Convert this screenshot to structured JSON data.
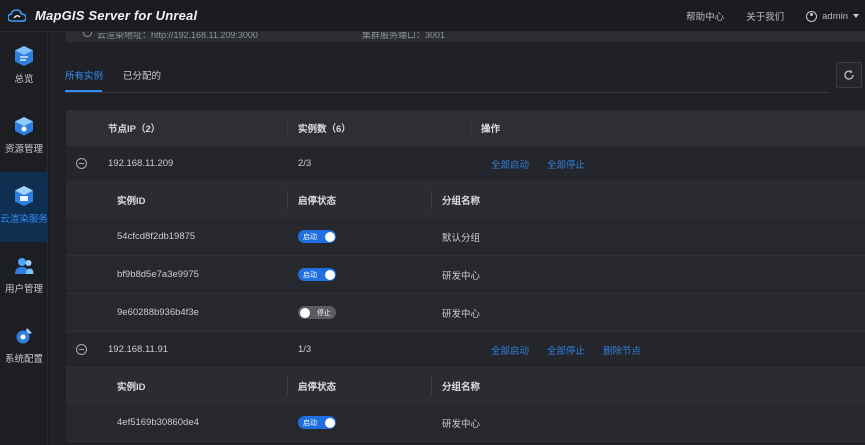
{
  "app": {
    "title": "MapGIS Server for Unreal"
  },
  "header": {
    "help": "帮助中心",
    "about": "关于我们",
    "user": "admin"
  },
  "sidebar": {
    "items": [
      {
        "label": "总览",
        "icon": "overview-icon",
        "active": false
      },
      {
        "label": "资源管理",
        "icon": "resource-icon",
        "active": false
      },
      {
        "label": "云渲染服务",
        "icon": "cloud-render-icon",
        "active": true
      },
      {
        "label": "用户管理",
        "icon": "users-icon",
        "active": false
      },
      {
        "label": "系统配置",
        "icon": "settings-icon",
        "active": false
      }
    ]
  },
  "info": {
    "address": "云渲染地址：http://192.168.11.209:3000",
    "port": "集群服务端口：3001"
  },
  "tabs": [
    {
      "label": "所有实例",
      "active": true
    },
    {
      "label": "已分配的",
      "active": false
    }
  ],
  "table": {
    "headers": {
      "node_ip": "节点IP（2）",
      "instances": "实例数（6）",
      "actions": "操作"
    },
    "sub_headers": {
      "id": "实例ID",
      "state": "启停状态",
      "group": "分组名称"
    },
    "actions": {
      "start_all": "全部启动",
      "stop_all": "全部停止",
      "delete_node": "删除节点"
    },
    "switch_labels": {
      "on": "启动",
      "off": "停止"
    },
    "nodes": [
      {
        "ip": "192.168.11.209",
        "count": "2/3",
        "instances": [
          {
            "id": "54cfcd8f2db19875",
            "running": true,
            "group": "默认分组"
          },
          {
            "id": "bf9b8d5e7a3e9975",
            "running": true,
            "group": "研发中心"
          },
          {
            "id": "9e60288b936b4f3e",
            "running": false,
            "group": "研发中心"
          }
        ]
      },
      {
        "ip": "192.168.11.91",
        "count": "1/3",
        "instances": [
          {
            "id": "4ef5169b30860de4",
            "running": true,
            "group": "研发中心"
          }
        ]
      }
    ]
  },
  "colors": {
    "accent": "#2f8df5",
    "switch_on": "#1f6fe0",
    "switch_off": "#5a5c61"
  }
}
